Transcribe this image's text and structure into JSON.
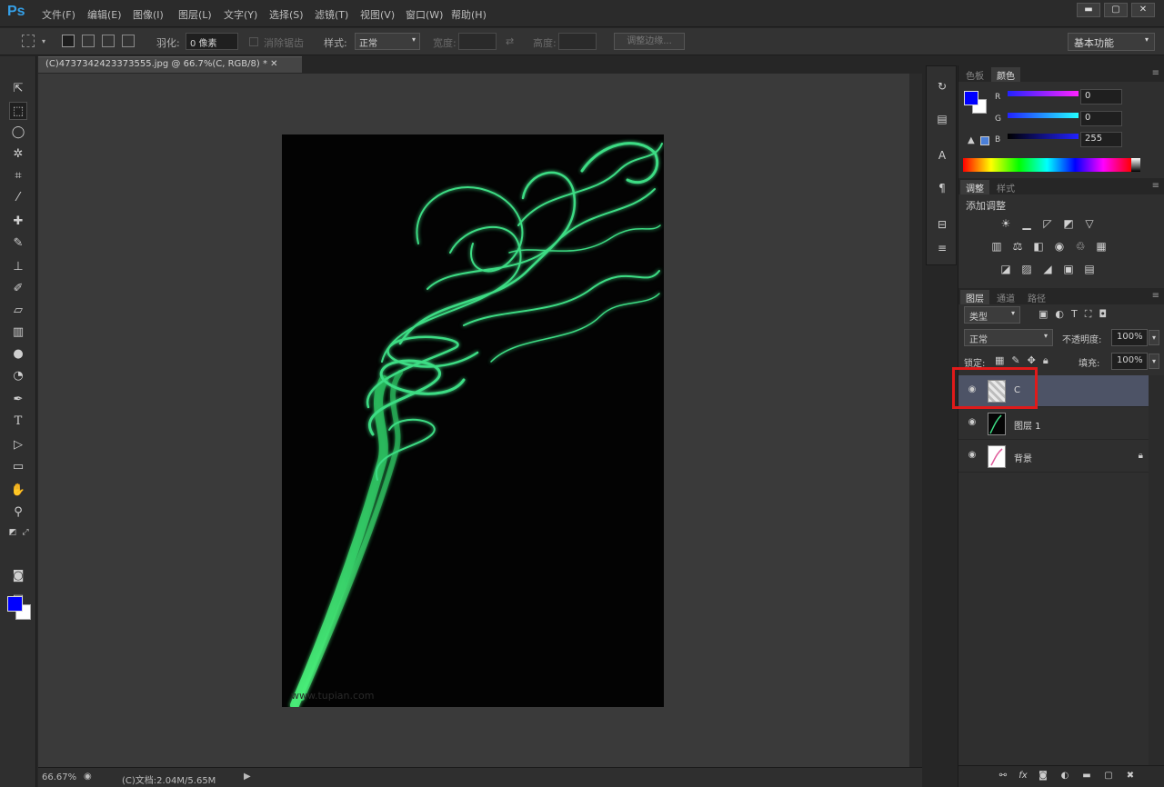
{
  "app": {
    "logo": "Ps"
  },
  "menu": [
    "文件(F)",
    "编辑(E)",
    "图像(I)",
    "图层(L)",
    "文字(Y)",
    "选择(S)",
    "滤镜(T)",
    "视图(V)",
    "窗口(W)",
    "帮助(H)"
  ],
  "window_controls": {
    "minimize": "▬",
    "restore": "▢",
    "close": "✕"
  },
  "options": {
    "feather_label": "羽化:",
    "feather_value": "0 像素",
    "antialias_label": "消除锯齿",
    "style_label": "样式:",
    "style_value": "正常",
    "width_label": "宽度:",
    "height_label": "高度:",
    "refine_button": "调整边缘...",
    "workspace": "基本功能"
  },
  "document": {
    "tab": "(C)4737342423373555.jpg @ 66.7%(C, RGB/8) * ✕",
    "zoom": "66.67%",
    "info": "(C)文档:2.04M/5.65M",
    "watermark": "www.tupian.com"
  },
  "color_panel": {
    "tabs": [
      "色板",
      "颜色"
    ],
    "active_tab": 1,
    "channels": [
      {
        "label": "R",
        "value": "0"
      },
      {
        "label": "G",
        "value": "0"
      },
      {
        "label": "B",
        "value": "255"
      }
    ],
    "fg_color": "#0000ff",
    "bg_color": "#ffffff"
  },
  "adjustments_panel": {
    "tabs": [
      "调整",
      "样式"
    ],
    "active_tab": 0,
    "title": "添加调整"
  },
  "layers_panel": {
    "tabs": [
      "图层",
      "通道",
      "路径"
    ],
    "active_tab": 0,
    "filter_kind": "类型",
    "blend_mode": "正常",
    "opacity_label": "不透明度:",
    "opacity_value": "100%",
    "lock_label": "锁定:",
    "fill_label": "填充:",
    "fill_value": "100%",
    "layers": [
      {
        "name": "C",
        "selected": true
      },
      {
        "name": "图层 1",
        "selected": false
      },
      {
        "name": "背景",
        "selected": false
      }
    ]
  },
  "smoke_color": "#3ddc84"
}
